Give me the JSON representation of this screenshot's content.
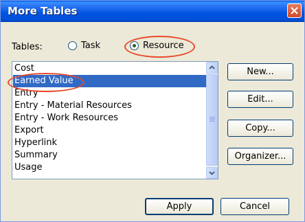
{
  "window": {
    "title": "More Tables"
  },
  "tables": {
    "label": "Tables:",
    "options": [
      {
        "label": "Task",
        "selected": false
      },
      {
        "label": "Resource",
        "selected": true
      }
    ]
  },
  "list": {
    "items": [
      {
        "label": "Cost",
        "selected": false
      },
      {
        "label": "Earned Value",
        "selected": true
      },
      {
        "label": "Entry",
        "selected": false
      },
      {
        "label": "Entry - Material Resources",
        "selected": false
      },
      {
        "label": "Entry - Work Resources",
        "selected": false
      },
      {
        "label": "Export",
        "selected": false
      },
      {
        "label": "Hyperlink",
        "selected": false
      },
      {
        "label": "Summary",
        "selected": false
      },
      {
        "label": "Usage",
        "selected": false
      }
    ]
  },
  "buttons": {
    "new": "New...",
    "edit": "Edit...",
    "copy": "Copy...",
    "organizer": "Organizer...",
    "apply": "Apply",
    "cancel": "Cancel"
  },
  "colors": {
    "highlight": "#316ac5",
    "annotation": "#e84a2a"
  }
}
